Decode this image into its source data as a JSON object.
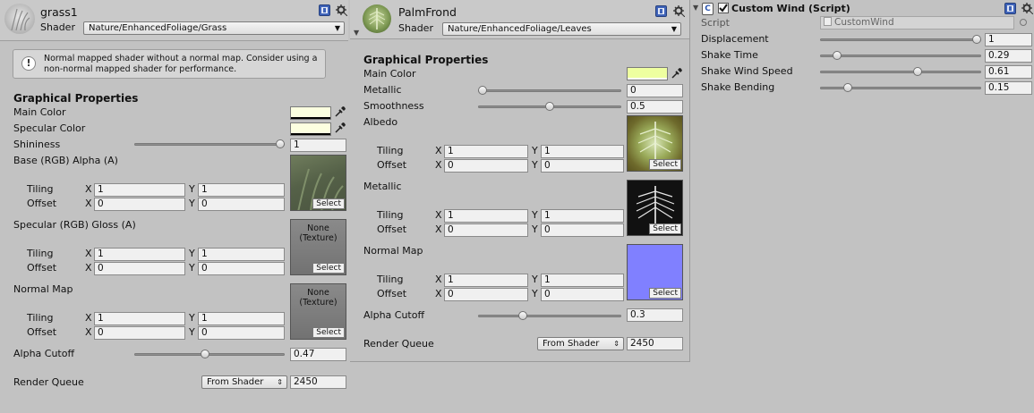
{
  "grass": {
    "title": "grass1",
    "shader_label": "Shader",
    "shader_value": "Nature/EnhancedFoliage/Grass",
    "help_text_line1": "Normal mapped shader without a normal map. Consider using a",
    "help_text_line2": "non-normal mapped shader for performance.",
    "section": "Graphical Properties",
    "main_color_label": "Main Color",
    "main_color": "#fbffe0",
    "specular_color_label": "Specular Color",
    "specular_color": "#fcffe0",
    "shininess_label": "Shininess",
    "shininess_value": "1",
    "shininess_fraction": 1.0,
    "base_label": "Base (RGB) Alpha (A)",
    "tiling_label": "Tiling",
    "offset_label": "Offset",
    "x_label": "X",
    "y_label": "Y",
    "base_tiling_x": "1",
    "base_tiling_y": "1",
    "base_offset_x": "0",
    "base_offset_y": "0",
    "spec_label": "Specular (RGB) Gloss (A)",
    "spec_tiling_x": "1",
    "spec_tiling_y": "1",
    "spec_offset_x": "0",
    "spec_offset_y": "0",
    "none_line1": "None",
    "none_line2": "(Texture)",
    "normal_label": "Normal Map",
    "normal_tiling_x": "1",
    "normal_tiling_y": "1",
    "normal_offset_x": "0",
    "normal_offset_y": "0",
    "select_label": "Select",
    "alpha_cutoff_label": "Alpha Cutoff",
    "alpha_cutoff_value": "0.47",
    "alpha_cutoff_fraction": 0.47,
    "render_queue_label": "Render Queue",
    "render_queue_mode": "From Shader",
    "render_queue_value": "2450"
  },
  "palm": {
    "title": "PalmFrond",
    "shader_label": "Shader",
    "shader_value": "Nature/EnhancedFoliage/Leaves",
    "section": "Graphical Properties",
    "main_color_label": "Main Color",
    "main_color": "#eeffa0",
    "metallic_label": "Metallic",
    "metallic_value": "0",
    "metallic_fraction": 0.0,
    "smoothness_label": "Smoothness",
    "smoothness_value": "0.5",
    "smoothness_fraction": 0.5,
    "albedo_label": "Albedo",
    "tiling_label": "Tiling",
    "offset_label": "Offset",
    "x_label": "X",
    "y_label": "Y",
    "albedo_tiling_x": "1",
    "albedo_tiling_y": "1",
    "albedo_offset_x": "0",
    "albedo_offset_y": "0",
    "metallic_map_label": "Metallic",
    "metallic_tiling_x": "1",
    "metallic_tiling_y": "1",
    "metallic_offset_x": "0",
    "metallic_offset_y": "0",
    "normal_label": "Normal Map",
    "normal_tiling_x": "1",
    "normal_tiling_y": "1",
    "normal_offset_x": "0",
    "normal_offset_y": "0",
    "select_label": "Select",
    "alpha_cutoff_label": "Alpha Cutoff",
    "alpha_cutoff_value": "0.3",
    "alpha_cutoff_fraction": 0.3,
    "render_queue_label": "Render Queue",
    "render_queue_mode": "From Shader",
    "render_queue_value": "2450"
  },
  "wind": {
    "title": "Custom Wind (Script)",
    "enabled": true,
    "script_label": "Script",
    "script_value": "CustomWind",
    "displacement_label": "Displacement",
    "displacement_value": "1",
    "displacement_fraction": 1.0,
    "shake_time_label": "Shake Time",
    "shake_time_value": "0.29",
    "shake_time_fraction": 0.08,
    "shake_speed_label": "Shake Wind Speed",
    "shake_speed_value": "0.61",
    "shake_speed_fraction": 0.61,
    "shake_bending_label": "Shake Bending",
    "shake_bending_value": "0.15",
    "shake_bending_fraction": 0.15
  },
  "icons": {
    "help": "help-book-icon",
    "settings": "gear-icon",
    "picker": "eyedropper-icon",
    "script": "script-icon"
  }
}
